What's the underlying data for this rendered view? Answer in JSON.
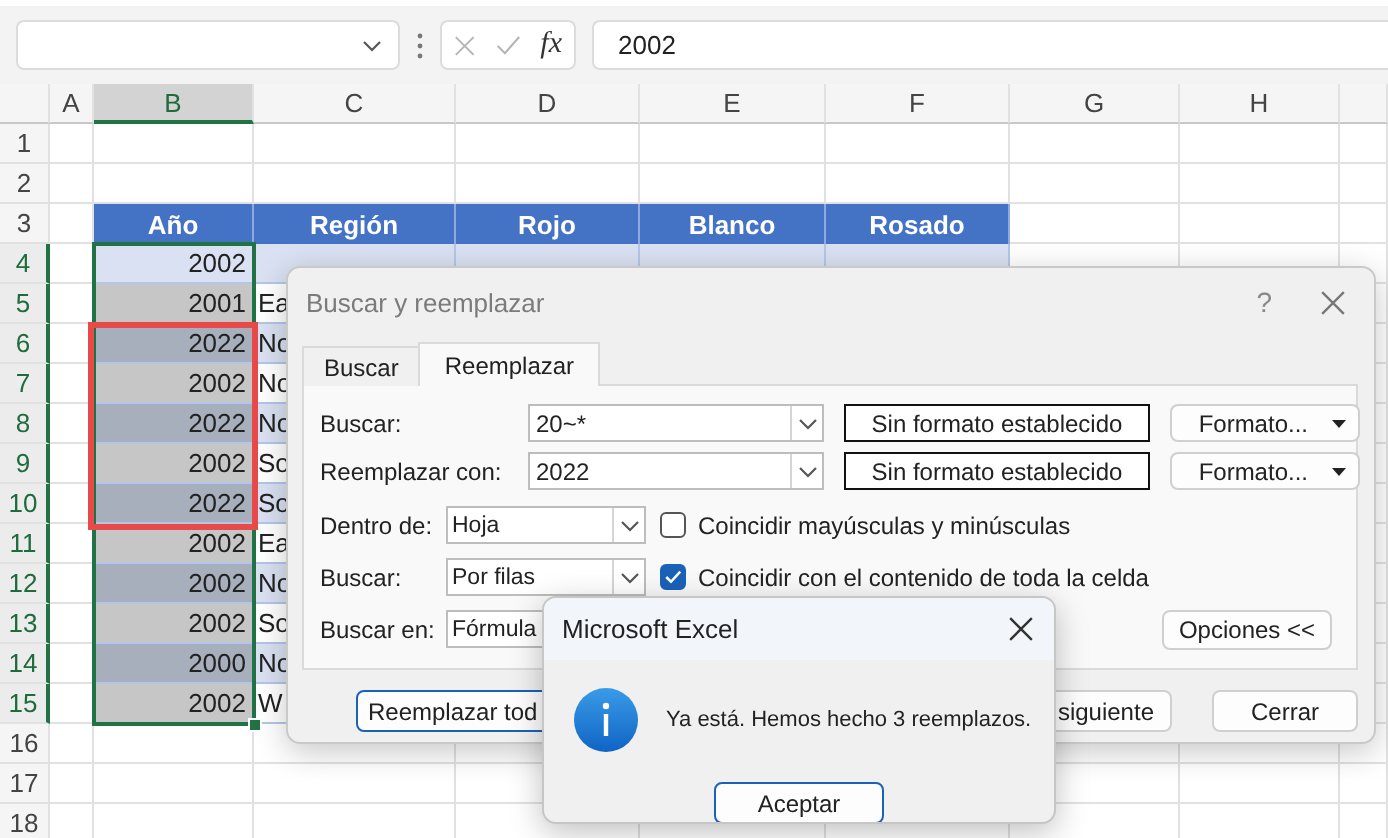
{
  "formula_bar": {
    "function_label": "fx",
    "value": "2002"
  },
  "sheet": {
    "columns": [
      {
        "label": "A",
        "selected": false
      },
      {
        "label": "B",
        "selected": true
      },
      {
        "label": "C",
        "selected": false
      },
      {
        "label": "D",
        "selected": false
      },
      {
        "label": "E",
        "selected": false
      },
      {
        "label": "F",
        "selected": false
      },
      {
        "label": "G",
        "selected": false
      },
      {
        "label": "H",
        "selected": false
      }
    ],
    "rows": [
      {
        "label": "1",
        "selected": false
      },
      {
        "label": "2",
        "selected": false
      },
      {
        "label": "3",
        "selected": false
      },
      {
        "label": "4",
        "selected": true
      },
      {
        "label": "5",
        "selected": true
      },
      {
        "label": "6",
        "selected": true
      },
      {
        "label": "7",
        "selected": true
      },
      {
        "label": "8",
        "selected": true
      },
      {
        "label": "9",
        "selected": true
      },
      {
        "label": "10",
        "selected": true
      },
      {
        "label": "11",
        "selected": true
      },
      {
        "label": "12",
        "selected": true
      },
      {
        "label": "13",
        "selected": true
      },
      {
        "label": "14",
        "selected": true
      },
      {
        "label": "15",
        "selected": true
      },
      {
        "label": "16",
        "selected": false
      },
      {
        "label": "17",
        "selected": false
      },
      {
        "label": "18",
        "selected": false
      }
    ],
    "table": {
      "columns": [
        "Año",
        "Región",
        "Rojo",
        "Blanco",
        "Rosado"
      ],
      "rows": [
        {
          "year": "2002",
          "selected": true,
          "active": true,
          "highlighted": false
        },
        {
          "year": "2001",
          "region": "Ea",
          "selected": true,
          "active": false,
          "highlighted": false
        },
        {
          "year": "2022",
          "region": "No",
          "selected": true,
          "active": false,
          "highlighted": true
        },
        {
          "year": "2002",
          "region": "No",
          "selected": true,
          "active": false,
          "highlighted": true
        },
        {
          "year": "2022",
          "region": "No",
          "selected": true,
          "active": false,
          "highlighted": true
        },
        {
          "year": "2002",
          "region": "So",
          "selected": true,
          "active": false,
          "highlighted": true
        },
        {
          "year": "2022",
          "region": "So",
          "selected": true,
          "active": false,
          "highlighted": true
        },
        {
          "year": "2002",
          "region": "Ea",
          "selected": true,
          "active": false,
          "highlighted": false
        },
        {
          "year": "2002",
          "region": "No",
          "selected": true,
          "active": false,
          "highlighted": false
        },
        {
          "year": "2002",
          "region": "So",
          "selected": true,
          "active": false,
          "highlighted": false
        },
        {
          "year": "2000",
          "region": "No",
          "selected": true,
          "active": false,
          "highlighted": false
        },
        {
          "year": "2002",
          "region": "W",
          "selected": true,
          "active": false,
          "highlighted": false
        }
      ]
    }
  },
  "find_replace": {
    "title": "Buscar y reemplazar",
    "help": "?",
    "tabs": [
      {
        "label": "Buscar",
        "selected": false
      },
      {
        "label": "Reemplazar",
        "selected": true
      }
    ],
    "fields": [
      {
        "label": "Buscar:",
        "value": "20~*",
        "format": "Sin formato establecido",
        "format_button": "Formato..."
      },
      {
        "label": "Reemplazar con:",
        "value": "2022",
        "format": "Sin formato establecido",
        "format_button": "Formato..."
      }
    ],
    "options": [
      {
        "label": "Dentro de:",
        "value": "Hoja"
      },
      {
        "label": "Buscar:",
        "value": "Por filas"
      },
      {
        "label": "Buscar en:",
        "value": "Fórmula"
      }
    ],
    "checkboxes": [
      {
        "label": "Coincidir mayúsculas y minúsculas",
        "checked": false
      },
      {
        "label": "Coincidir con el contenido de toda la celda",
        "checked": true
      }
    ],
    "options_button": "Opciones <<",
    "buttons": [
      "Reemplazar tod",
      "siguiente",
      "Cerrar"
    ]
  },
  "message_box": {
    "title": "Microsoft Excel",
    "message": "Ya está. Hemos hecho 3 reemplazos.",
    "button": "Aceptar"
  }
}
